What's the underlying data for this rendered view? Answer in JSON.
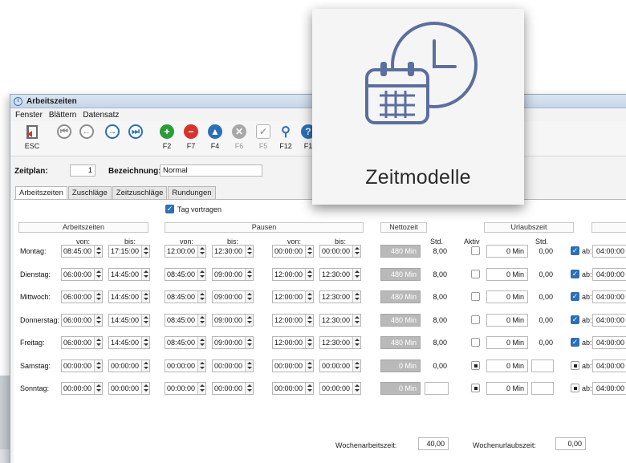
{
  "window": {
    "title": "Arbeitszeiten"
  },
  "menu": [
    "Fenster",
    "Blättern",
    "Datensatz"
  ],
  "toolbar": [
    {
      "icon": "exit-door-icon",
      "label": "ESC",
      "disabled": false
    },
    {
      "icon": "first-record-icon",
      "label": "",
      "disabled": false
    },
    {
      "icon": "previous-record-icon",
      "label": "",
      "disabled": false
    },
    {
      "icon": "next-record-icon",
      "label": "",
      "disabled": false
    },
    {
      "icon": "last-record-icon",
      "label": "",
      "disabled": false
    },
    {
      "icon": "add-icon",
      "label": "F2",
      "disabled": false
    },
    {
      "icon": "delete-icon",
      "label": "F7",
      "disabled": false
    },
    {
      "icon": "save-up-icon",
      "label": "F4",
      "disabled": false
    },
    {
      "icon": "cancel-icon",
      "label": "F6",
      "disabled": true
    },
    {
      "icon": "confirm-icon",
      "label": "F5",
      "disabled": true
    },
    {
      "icon": "search-icon",
      "label": "F12",
      "disabled": false
    },
    {
      "icon": "help-icon",
      "label": "F1",
      "disabled": false
    }
  ],
  "form": {
    "zeitplan_label": "Zeitplan:",
    "zeitplan_value": "1",
    "bezeichnung_label": "Bezeichnung:",
    "bezeichnung_value": "Normal"
  },
  "tabs": [
    "Arbeitszeiten",
    "Zuschläge",
    "Zeitzuschläge",
    "Rundungen"
  ],
  "tag_vortragen": {
    "label": "Tag vortragen",
    "checked": true
  },
  "sections": {
    "arbeitszeiten": "Arbeitszeiten",
    "pausen": "Pausen",
    "nettozeit": "Nettozeit",
    "urlaubszeit": "Urlaubszeit"
  },
  "headers": {
    "von": "von:",
    "bis": "bis:",
    "std": "Std.",
    "aktiv": "Aktiv",
    "ab": "ab:"
  },
  "days": [
    {
      "name": "Montag:",
      "az_von": "08:45:00",
      "az_bis": "17:15:00",
      "p1_von": "12:00:00",
      "p1_bis": "12:30:00",
      "p2_von": "00:00:00",
      "p2_bis": "00:00:00",
      "netto": "480 Min",
      "std": "8,00",
      "aktiv": false,
      "urlaub_min": "0 Min",
      "urlaub_std": "0,00",
      "ab_checked": true,
      "ab_value": "04:00:00"
    },
    {
      "name": "Dienstag:",
      "az_von": "06:00:00",
      "az_bis": "14:45:00",
      "p1_von": "08:45:00",
      "p1_bis": "09:00:00",
      "p2_von": "12:00:00",
      "p2_bis": "12:30:00",
      "netto": "480 Min",
      "std": "8,00",
      "aktiv": false,
      "urlaub_min": "0 Min",
      "urlaub_std": "0,00",
      "ab_checked": true,
      "ab_value": "04:00:00"
    },
    {
      "name": "Mittwoch:",
      "az_von": "06:00:00",
      "az_bis": "14:45:00",
      "p1_von": "08:45:00",
      "p1_bis": "09:00:00",
      "p2_von": "12:00:00",
      "p2_bis": "12:30:00",
      "netto": "480 Min",
      "std": "8,00",
      "aktiv": false,
      "urlaub_min": "0 Min",
      "urlaub_std": "0,00",
      "ab_checked": true,
      "ab_value": "04:00:00"
    },
    {
      "name": "Donnerstag:",
      "az_von": "06:00:00",
      "az_bis": "14:45:00",
      "p1_von": "08:45:00",
      "p1_bis": "09:00:00",
      "p2_von": "12:00:00",
      "p2_bis": "12:30:00",
      "netto": "480 Min",
      "std": "8,00",
      "aktiv": false,
      "urlaub_min": "0 Min",
      "urlaub_std": "0,00",
      "ab_checked": true,
      "ab_value": "04:00:00"
    },
    {
      "name": "Freitag:",
      "az_von": "06:00:00",
      "az_bis": "14:45:00",
      "p1_von": "08:45:00",
      "p1_bis": "09:00:00",
      "p2_von": "12:00:00",
      "p2_bis": "12:30:00",
      "netto": "480 Min",
      "std": "8,00",
      "aktiv": false,
      "urlaub_min": "0 Min",
      "urlaub_std": "0,00",
      "ab_checked": true,
      "ab_value": "04:00:00"
    },
    {
      "name": "Samstag:",
      "az_von": "00:00:00",
      "az_bis": "00:00:00",
      "p1_von": "00:00:00",
      "p1_bis": "00:00:00",
      "p2_von": "00:00:00",
      "p2_bis": "00:00:00",
      "netto": "0 Min",
      "std": "0,00",
      "aktiv": true,
      "urlaub_min": "0 Min",
      "urlaub_std": "",
      "ab_checked": false,
      "ab_value": "04:00:00"
    },
    {
      "name": "Sonntag:",
      "az_von": "00:00:00",
      "az_bis": "00:00:00",
      "p1_von": "00:00:00",
      "p1_bis": "00:00:00",
      "p2_von": "00:00:00",
      "p2_bis": "00:00:00",
      "netto": "0 Min",
      "std": "",
      "aktiv": true,
      "urlaub_min": "0 Min",
      "urlaub_std": "",
      "ab_checked": false,
      "ab_value": "04:00:00"
    }
  ],
  "footer": {
    "wochenarbeitszeit_label": "Wochenarbeitszeit:",
    "wochenarbeitszeit_value": "40,00",
    "wochenurlaubszeit_label": "Wochenurlaubszeit:",
    "wochenurlaubszeit_value": "0,00"
  },
  "overlay": {
    "title": "Zeitmodelle",
    "icon": "calendar-clock-icon"
  }
}
